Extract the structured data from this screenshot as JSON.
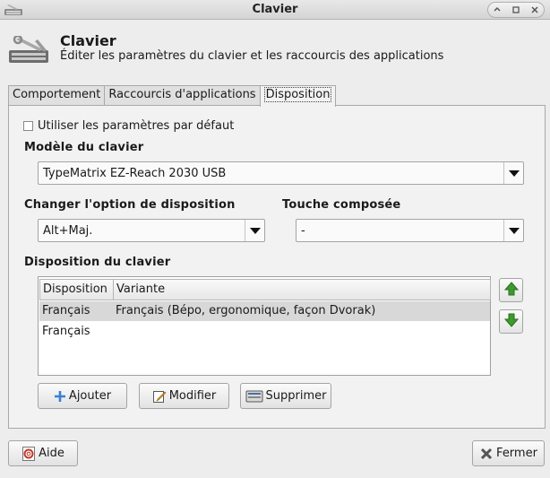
{
  "window": {
    "title": "Clavier"
  },
  "header": {
    "title": "Clavier",
    "subtitle": "Éditer les paramètres du clavier et les raccourcis des applications"
  },
  "tabs": [
    {
      "label": "Comportement",
      "active": false
    },
    {
      "label": "Raccourcis d'applications",
      "active": false
    },
    {
      "label": "Disposition",
      "active": true
    }
  ],
  "layout_tab": {
    "use_defaults_label": "Utiliser les paramètres par défaut",
    "use_defaults_checked": false,
    "keyboard_model_label": "Modèle du clavier",
    "keyboard_model_value": "TypeMatrix EZ-Reach 2030 USB",
    "change_option_label": "Changer l'option de disposition",
    "change_option_value": "Alt+Maj.",
    "compose_key_label": "Touche composée",
    "compose_key_value": "-",
    "layout_label": "Disposition du clavier",
    "table": {
      "columns": [
        "Disposition",
        "Variante"
      ],
      "rows": [
        {
          "layout": "Français",
          "variant": "Français (Bépo, ergonomique, façon Dvorak)",
          "selected": true
        },
        {
          "layout": "Français",
          "variant": "",
          "selected": false
        }
      ]
    },
    "buttons": {
      "add": "Ajouter",
      "edit": "Modifier",
      "delete": "Supprimer"
    }
  },
  "footer": {
    "help": "Aide",
    "close": "Fermer"
  },
  "icons": {
    "app": "keyboard-icon",
    "minimize": "minimize-icon",
    "maximize": "maximize-icon",
    "close": "close-icon",
    "move_up": "arrow-up-icon",
    "move_down": "arrow-down-icon",
    "add": "plus-icon",
    "edit": "edit-icon",
    "delete": "keyboard-remove-icon",
    "help": "help-icon",
    "close_button": "x-icon"
  },
  "colors": {
    "arrow_green": "#3c9a2e",
    "add_blue": "#3a7fd5"
  }
}
